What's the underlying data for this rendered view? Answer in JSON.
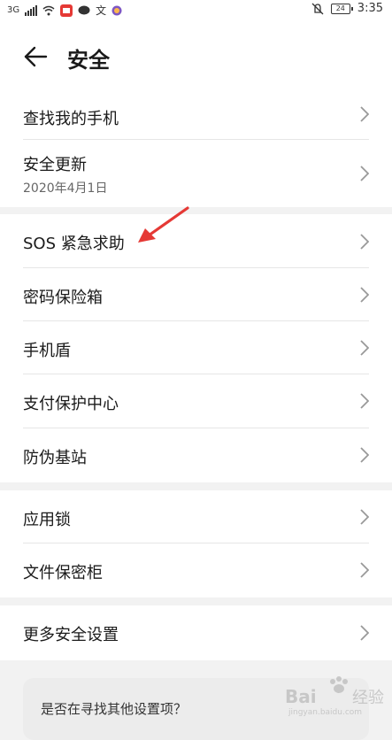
{
  "status_bar": {
    "network": "3G",
    "battery": "24",
    "time": "3:35"
  },
  "header": {
    "title": "安全"
  },
  "groups": [
    {
      "items": [
        {
          "label": "查找我的手机"
        },
        {
          "label": "安全更新",
          "sub": "2020年4月1日"
        }
      ]
    },
    {
      "items": [
        {
          "label": "SOS 紧急求助"
        },
        {
          "label": "密码保险箱"
        },
        {
          "label": "手机盾"
        },
        {
          "label": "支付保护中心"
        },
        {
          "label": "防伪基站"
        }
      ]
    },
    {
      "items": [
        {
          "label": "应用锁"
        },
        {
          "label": "文件保密柜"
        }
      ]
    },
    {
      "items": [
        {
          "label": "更多安全设置"
        }
      ]
    }
  ],
  "suggestion": {
    "text": "是否在寻找其他设置项？"
  },
  "colors": {
    "annotation_arrow": "#e53935",
    "background": "#f2f2f2",
    "card": "#ffffff"
  },
  "watermark": {
    "text": "Bai经验",
    "subtext": "jingyan.baidu.com"
  }
}
